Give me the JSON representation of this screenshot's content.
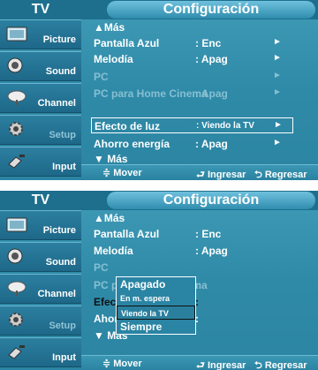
{
  "header": {
    "tv_label": "TV",
    "title": "Configuración"
  },
  "sidebar": [
    {
      "label": "Picture",
      "icon": "picture-icon",
      "state": "active"
    },
    {
      "label": "Sound",
      "icon": "speaker-icon",
      "state": "active"
    },
    {
      "label": "Channel",
      "icon": "satellite-dish-icon",
      "state": "active"
    },
    {
      "label": "Setup",
      "icon": "gear-icon",
      "state": "dim"
    },
    {
      "label": "Input",
      "icon": "plug-icon",
      "state": "active"
    }
  ],
  "panel1": {
    "rows": [
      {
        "label": "▲Más",
        "value": "",
        "arrow": ""
      },
      {
        "label": "Pantalla Azul",
        "value": ": Enc",
        "arrow": "►"
      },
      {
        "label": "Melodía",
        "value": ": Apag",
        "arrow": "►"
      },
      {
        "label": "PC",
        "value": "",
        "arrow": "►"
      },
      {
        "label": "PC para Home Cinema",
        "value": ": Apag",
        "arrow": "►"
      },
      {
        "label": "Efecto de luz",
        "value": ": Viendo la TV",
        "arrow": "►"
      },
      {
        "label": "Ahorro energía",
        "value": ": Apag",
        "arrow": "►"
      },
      {
        "label": "▼ Más",
        "value": "",
        "arrow": ""
      }
    ]
  },
  "panel2": {
    "rows": [
      {
        "label": "▲Más",
        "value": ""
      },
      {
        "label": "Pantalla Azul",
        "value": ": Enc"
      },
      {
        "label": "Melodía",
        "value": ": Apag"
      },
      {
        "label": "PC",
        "value": ""
      },
      {
        "label": "PC para Home Cinema",
        "value": ":"
      },
      {
        "label": "Efecto de luz",
        "value": ":"
      },
      {
        "label": "Ahorro energía",
        "value": ":"
      },
      {
        "label": "▼ Más",
        "value": ""
      }
    ],
    "popup_options": [
      "Apagado",
      "En m. espera",
      "Viendo la TV",
      "Siempre"
    ],
    "popup_selected": "Viendo la TV"
  },
  "footer": {
    "move": "≑ Mover",
    "enter": "⮐ Ingresar",
    "return": "⮌ Regresar"
  }
}
